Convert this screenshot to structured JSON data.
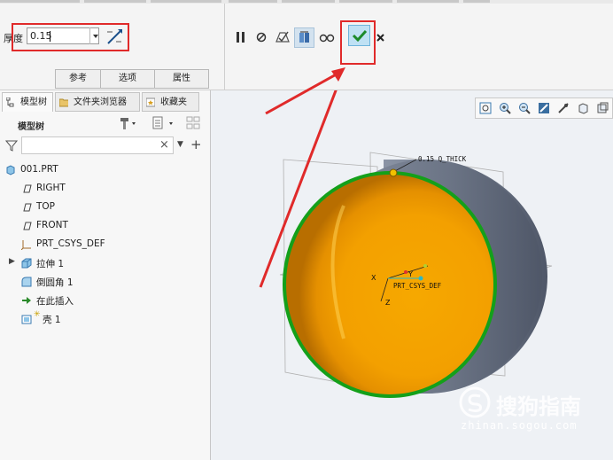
{
  "dashboard": {
    "thickness_label": "厚度",
    "thickness_value": "0.15",
    "tabs": [
      "参考",
      "选项",
      "属性"
    ],
    "icons": [
      "pause-icon",
      "stop-icon",
      "verify-icon",
      "preview-icon",
      "glasses-icon",
      "checkmark-icon",
      "close-icon"
    ]
  },
  "model_tree": {
    "tabs": [
      "模型树",
      "文件夹浏览器",
      "收藏夹"
    ],
    "title": "模型树",
    "filter_placeholder": "",
    "items": [
      {
        "label": "001.PRT",
        "icon": "part-icon"
      },
      {
        "label": "RIGHT",
        "icon": "datum-plane-icon"
      },
      {
        "label": "TOP",
        "icon": "datum-plane-icon"
      },
      {
        "label": "FRONT",
        "icon": "datum-plane-icon"
      },
      {
        "label": "PRT_CSYS_DEF",
        "icon": "csys-icon"
      },
      {
        "label": "拉伸 1",
        "icon": "extrude-icon"
      },
      {
        "label": "倒圆角 1",
        "icon": "round-icon"
      },
      {
        "label": "在此插入",
        "icon": "insert-arrow-icon"
      },
      {
        "label": "壳 1",
        "icon": "shell-icon"
      }
    ]
  },
  "viewport": {
    "thick_annotation": "0.15 Q_THICK",
    "csys_label": "PRT_CSYS_DEF",
    "axis_x": "X",
    "axis_y": "Y",
    "axis_z": "Z",
    "colors": {
      "shell_inner": "#f3a000",
      "shell_edge": "#14a01a",
      "body": "#6b7485"
    }
  },
  "watermark": {
    "brand": "搜狗指南",
    "url": "zhinan.sogou.com"
  }
}
